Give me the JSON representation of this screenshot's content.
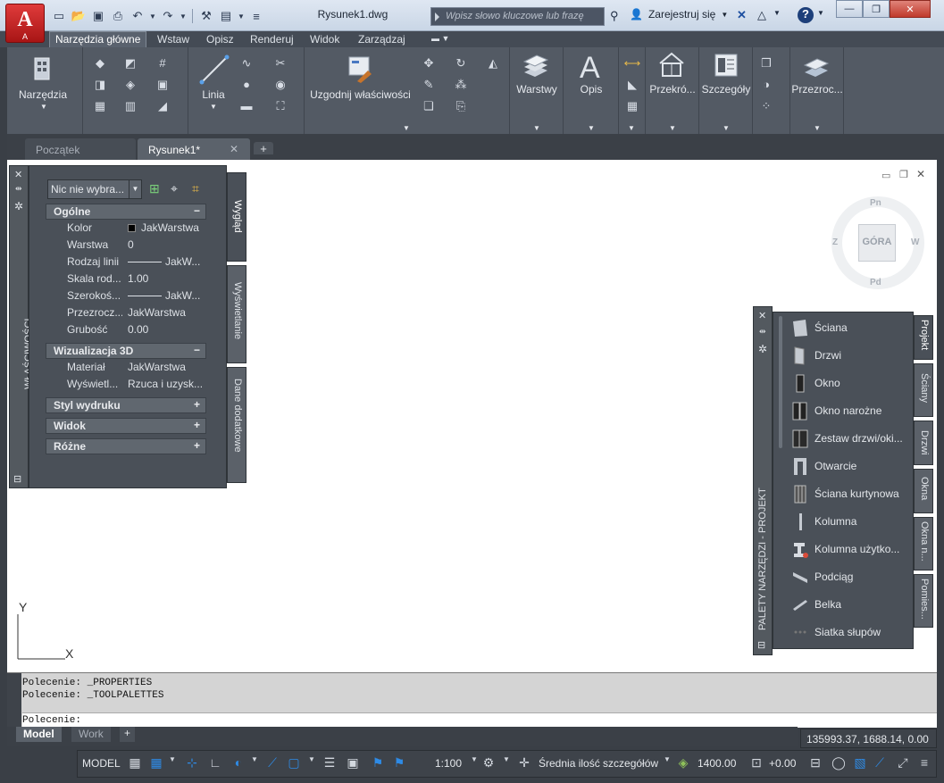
{
  "app": {
    "logo_letter": "A",
    "logo_sub": "A",
    "doc_title": "Rysunek1.dwg",
    "search_placeholder": "Wpisz słowo kluczowe lub frazę",
    "signin_label": "Zarejestruj się"
  },
  "ribbon_tabs": [
    "Narzędzia główne",
    "Wstaw",
    "Opisz",
    "Renderuj",
    "Widok",
    "Zarządzaj"
  ],
  "ribbon": {
    "tools_label": "Narzędzia",
    "line_label": "Linia",
    "match_label": "Uzgodnij właściwości",
    "layers_label": "Warstwy",
    "annotate_label": "Opis",
    "section_label": "Przekró...",
    "details_label": "Szczegóły",
    "transparency_label": "Przezroc..."
  },
  "doc_tabs": [
    "Początek",
    "Rysunek1*"
  ],
  "properties": {
    "title": "WŁAŚCIWOŚCI",
    "selection": "Nic nie wybra...",
    "tabs": [
      "Wygląd",
      "Wyświetlanie",
      "Dane dodatkowe"
    ],
    "general_header": "Ogólne",
    "general_rows": [
      {
        "key": "Kolor",
        "value": "JakWarstwa"
      },
      {
        "key": "Warstwa",
        "value": "0"
      },
      {
        "key": "Rodzaj linii",
        "value": "JakW..."
      },
      {
        "key": "Skala rod...",
        "value": "1.00"
      },
      {
        "key": "Szerokoś...",
        "value": "JakW..."
      },
      {
        "key": "Przezrocz...",
        "value": "JakWarstwa"
      },
      {
        "key": "Grubość",
        "value": "0.00"
      }
    ],
    "viz_header": "Wizualizacja 3D",
    "viz_rows": [
      {
        "key": "Materiał",
        "value": "JakWarstwa"
      },
      {
        "key": "Wyświetl...",
        "value": "Rzuca i uzysk..."
      }
    ],
    "collapsed": [
      "Styl wydruku",
      "Widok",
      "Różne"
    ]
  },
  "viewcube": {
    "top": "GÓRA",
    "n": "Pn",
    "s": "Pd",
    "w": "Z",
    "e": "W"
  },
  "tool_palette": {
    "title": "PALETY NARZĘDZI - PROJEKT",
    "tabs": [
      "Projekt",
      "Ściany",
      "Drzwi",
      "Okna",
      "Okna n...",
      "Pomies..."
    ],
    "items": [
      "Ściana",
      "Drzwi",
      "Okno",
      "Okno narożne",
      "Zestaw drzwi/oki...",
      "Otwarcie",
      "Ściana kurtynowa",
      "Kolumna",
      "Kolumna użytko...",
      "Podciąg",
      "Belka",
      "Siatka słupów"
    ]
  },
  "ucs": {
    "y": "Y",
    "x": "X"
  },
  "command": {
    "history": [
      "Polecenie:  _PROPERTIES",
      "Polecenie:  _TOOLPALETTES"
    ],
    "prompt": "Polecenie:"
  },
  "layout_tabs": [
    "Model",
    "Work"
  ],
  "coords": "135993.37, 1688.14, 0.00",
  "status": {
    "model": "MODEL",
    "scale": "1:100",
    "detail": "Średnia ilość szczegółów",
    "elevation": "1400.00",
    "offset": "+0.00"
  }
}
